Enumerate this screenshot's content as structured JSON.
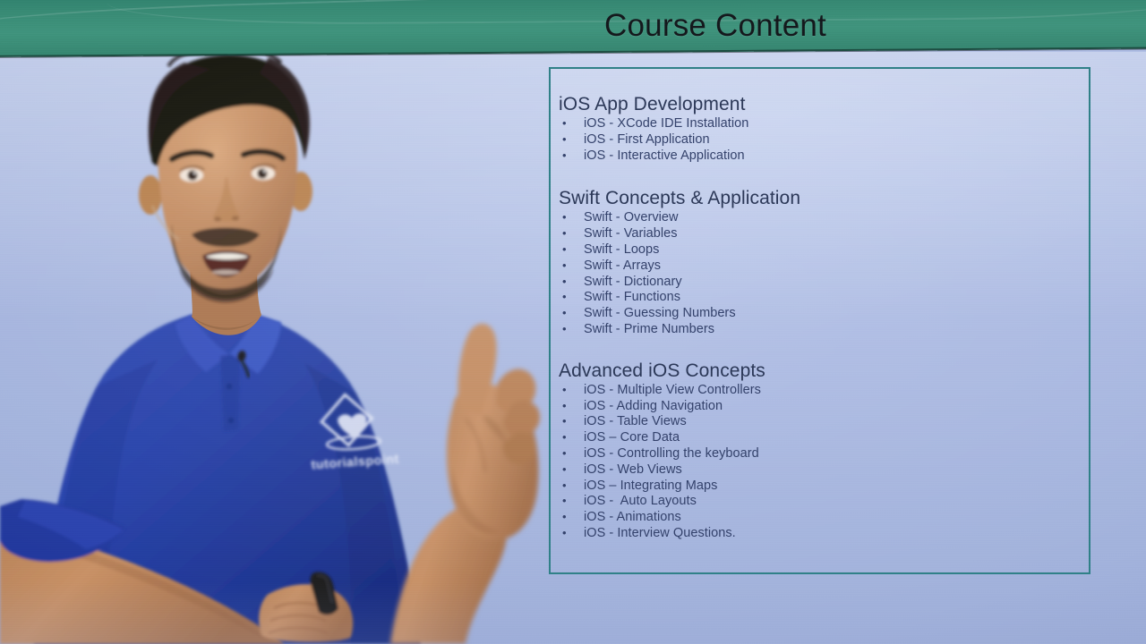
{
  "header": {
    "title": "Course Content",
    "banner_color": "#388973",
    "title_color": "#14181c"
  },
  "background": {
    "wall_color": "#a9b8e2",
    "box_border_color": "#2f7f86"
  },
  "slide": {
    "text_color": "#33416a",
    "heading_color": "#2b3757",
    "sections": [
      {
        "heading": "iOS App Development",
        "items": [
          "iOS - XCode IDE Installation",
          "iOS - First Application",
          "iOS - Interactive Application"
        ]
      },
      {
        "heading": "Swift Concepts & Application",
        "items": [
          "Swift - Overview",
          "Swift - Variables",
          "Swift - Loops",
          "Swift - Arrays",
          "Swift - Dictionary",
          "Swift - Functions",
          "Swift - Guessing Numbers",
          "Swift - Prime Numbers"
        ]
      },
      {
        "heading": "Advanced iOS Concepts",
        "items": [
          "iOS - Multiple View Controllers",
          "iOS - Adding Navigation",
          "iOS - Table Views",
          "iOS – Core Data",
          "iOS - Controlling the keyboard",
          "iOS - Web Views",
          "iOS – Integrating Maps",
          "iOS -  Auto Layouts",
          "iOS - Animations",
          "iOS - Interview Questions."
        ]
      }
    ]
  },
  "presenter": {
    "shirt_color": "#2741a8",
    "skin_color": "#c08b62",
    "hair_color": "#17120f",
    "logo_text": "tutorialspoint",
    "holding": "presenter-remote"
  }
}
